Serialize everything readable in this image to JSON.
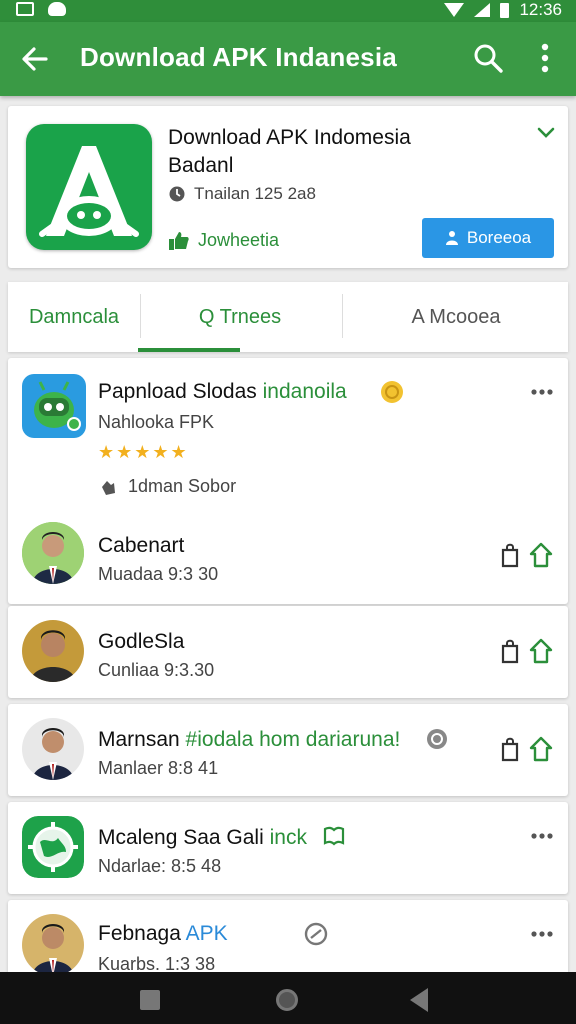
{
  "status_bar": {
    "time": "12:36",
    "left_icons": [
      "image-icon",
      "notification-icon"
    ],
    "right_icons": [
      "wifi-icon",
      "signal-icon",
      "battery-icon"
    ]
  },
  "app_bar": {
    "title": "Download APK Indanesia",
    "icons": [
      "back-arrow-icon",
      "search-icon",
      "more-vert-icon"
    ]
  },
  "header_card": {
    "title": "Download APK Indomesia",
    "subtitle": "Badanl",
    "meta": "Tnailan 125 2a8",
    "link_label": "Jowheetia",
    "button_label": "Boreeoa"
  },
  "tabs": [
    {
      "label": "Damncala"
    },
    {
      "label": "Q Trnees"
    },
    {
      "label": "A Mcooea"
    }
  ],
  "featured": {
    "name_black": "Papnload Slodas ",
    "name_green": "indanoila",
    "subtitle": "Nahlooka FPK",
    "stars": "★★★★★",
    "rating": 5,
    "meta": "1dman Sobor"
  },
  "rows": [
    {
      "name": "Cabenart",
      "time": "Muadaa 9:3 30"
    },
    {
      "name": "GodleSla",
      "time": "Cunliaa 9:3.30"
    },
    {
      "name_black": "Marnsan ",
      "name_green": "#iodala hom dariaruna!",
      "time": "Manlaer 8:8 41"
    },
    {
      "name_black": "Mcaleng Saa Gali ",
      "name_green": "inck",
      "time": "Ndarlae: 8:5 48"
    },
    {
      "name_black": "Febnaga ",
      "name_blue": "APK",
      "time": "Kuarbs. 1:3 38"
    }
  ],
  "colors": {
    "primary": "#3a9a45",
    "status": "#2f8e3a",
    "accent_blue": "#2a96e5",
    "star": "#f2b01e"
  }
}
